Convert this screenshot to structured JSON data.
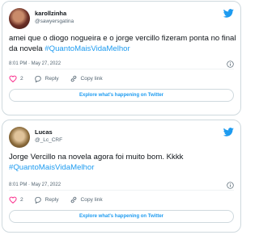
{
  "tweets": [
    {
      "display_name": "karollzinha",
      "handle": "@sawyersgatina",
      "text_main": "amei que o diogo nogueira e o jorge vercillo fizeram ponta no final da novela ",
      "hashtag": "#QuantoMaisVidaMelhor",
      "time": "8:01 PM · May 27, 2022",
      "like_count": "2",
      "reply_label": "Reply",
      "copy_label": "Copy link",
      "explore_label": "Explore what's happening on Twitter"
    },
    {
      "display_name": "Lucas",
      "handle": "@_Lc_CRF",
      "text_main": "Jorge Vercillo na novela agora foi muito bom. Kkkk",
      "hashtag": "#QuantoMaisVidaMelhor",
      "time": "8:01 PM · May 27, 2022",
      "like_count": "2",
      "reply_label": "Reply",
      "copy_label": "Copy link",
      "explore_label": "Explore what's happening on Twitter"
    }
  ],
  "colors": {
    "accent": "#1d9bf0",
    "text": "#0f1419",
    "muted": "#536471",
    "border": "#cfd9de"
  },
  "icons": [
    "twitter-bird-icon",
    "info-icon",
    "heart-icon",
    "reply-icon",
    "link-icon"
  ]
}
